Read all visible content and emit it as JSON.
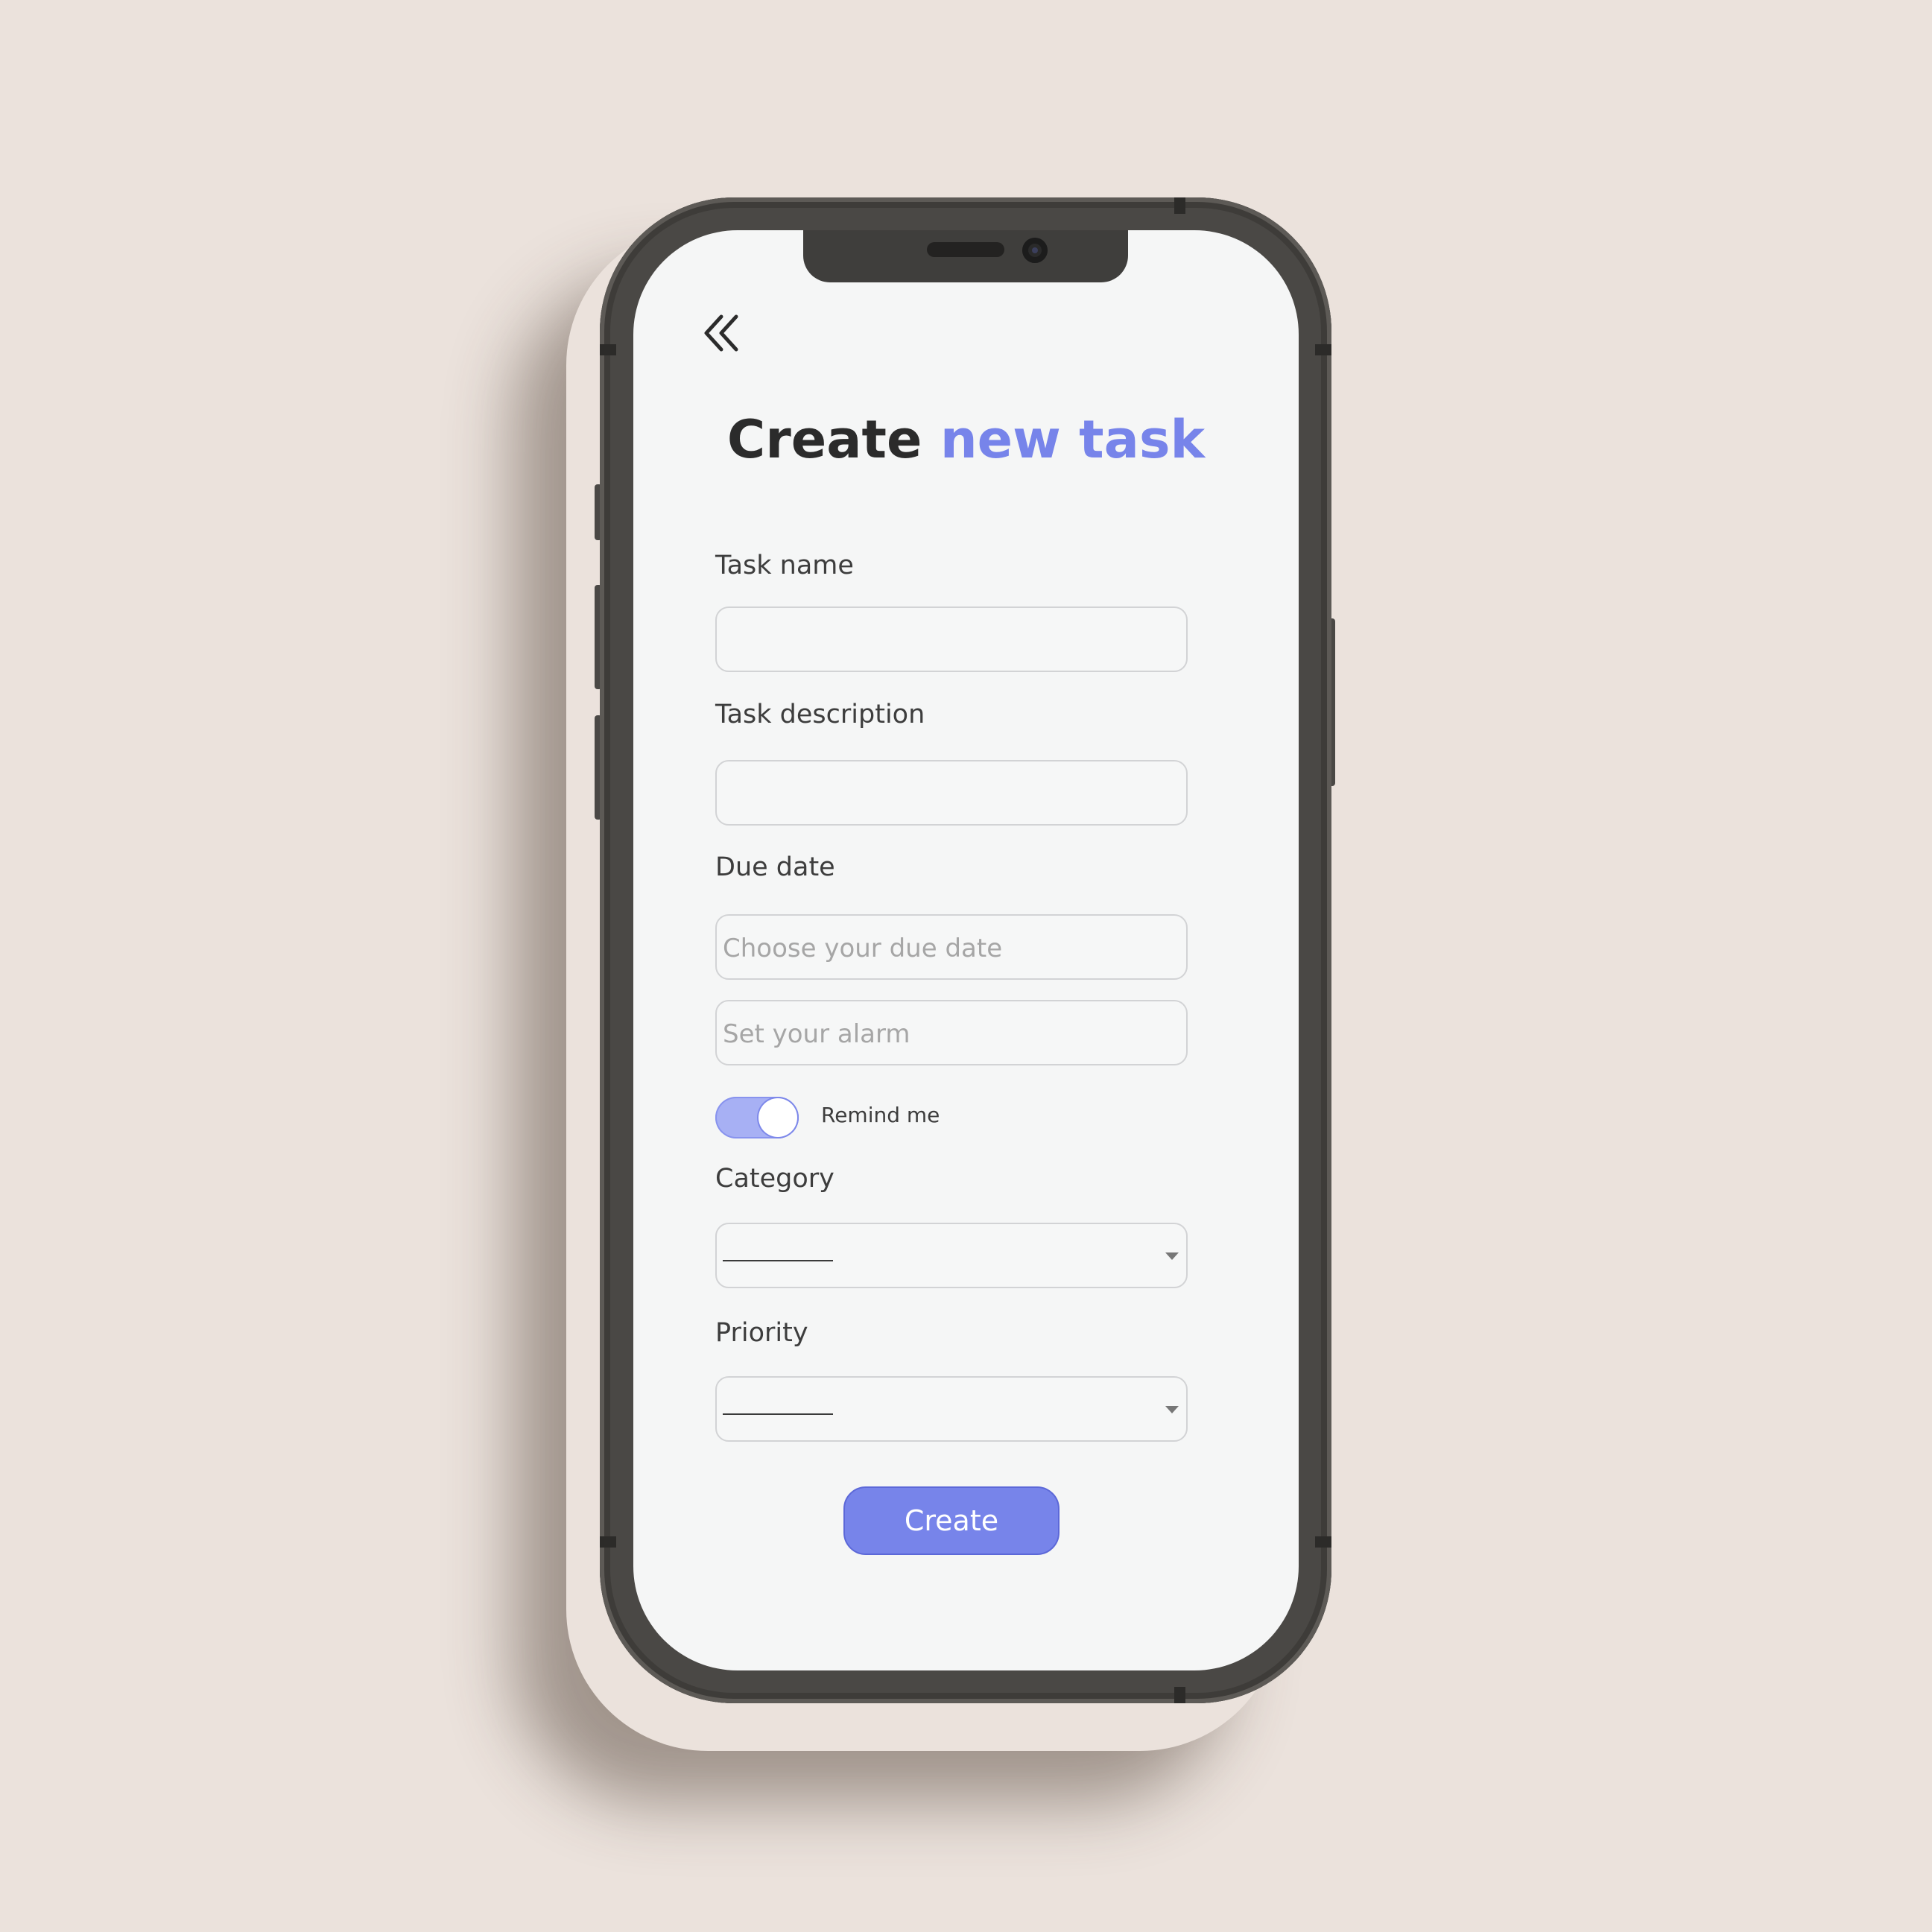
{
  "page": {
    "title_part1": "Create",
    "title_part2": "new task",
    "accent_color": "#7784ea",
    "back_icon": "double-chevron-left-icon"
  },
  "form": {
    "task_name_label": "Task name",
    "task_name_value": "",
    "task_description_label": "Task description",
    "task_description_value": "",
    "due_date_label": "Due date",
    "due_date_placeholder": "Choose your due date",
    "alarm_placeholder": "Set your alarm",
    "remind_label": "Remind me",
    "remind_enabled": true,
    "category_label": "Category",
    "category_selected": "",
    "priority_label": "Priority",
    "priority_selected": "",
    "create_label": "Create"
  }
}
